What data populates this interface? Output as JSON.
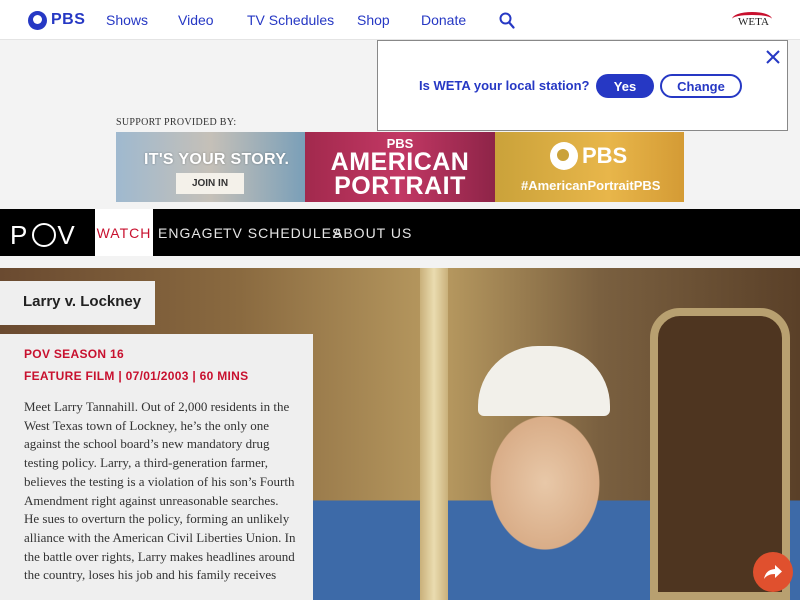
{
  "pbs_nav": {
    "logo_text": "PBS",
    "links": [
      "Shows",
      "Video",
      "TV Schedules",
      "Shop",
      "Donate"
    ],
    "station_logo_text": "WETA"
  },
  "support": {
    "label": "SUPPORT PROVIDED BY:",
    "ad_left_headline": "IT'S YOUR STORY.",
    "ad_left_button": "JOIN IN",
    "ad_mid_pbs": "PBS",
    "ad_mid_line1": "AMERICAN",
    "ad_mid_line2": "PORTRAIT",
    "ad_right_logo": "PBS",
    "ad_right_tag": "#AmericanPortraitPBS"
  },
  "station_popup": {
    "question": "Is WETA your local station?",
    "yes_label": "Yes",
    "change_label": "Change"
  },
  "pov_nav": {
    "logo_p": "P",
    "logo_v": "V",
    "items": [
      "WATCH",
      "ENGAGE",
      "TV SCHEDULES",
      "ABOUT US"
    ]
  },
  "episode": {
    "title": "Larry v. Lockney",
    "season": "POV SEASON 16",
    "meta": "FEATURE FILM | 07/01/2003 | 60 MINS",
    "description": "Meet Larry Tannahill. Out of 2,000 residents in the West Texas town of Lockney, he’s the only one against the school board’s new mandatory drug testing policy. Larry, a third-generation farmer, believes the testing is a violation of his son’s Fourth Amendment right against unreasonable searches. He sues to overturn the policy, forming an unlikely alliance with the American Civil Liberties Union. In the battle over rights, Larry makes headlines around the country, loses his job and his family receives"
  },
  "colors": {
    "pbs_blue": "#2638c4",
    "pov_red": "#c8102e",
    "share_orange": "#e0502e"
  }
}
